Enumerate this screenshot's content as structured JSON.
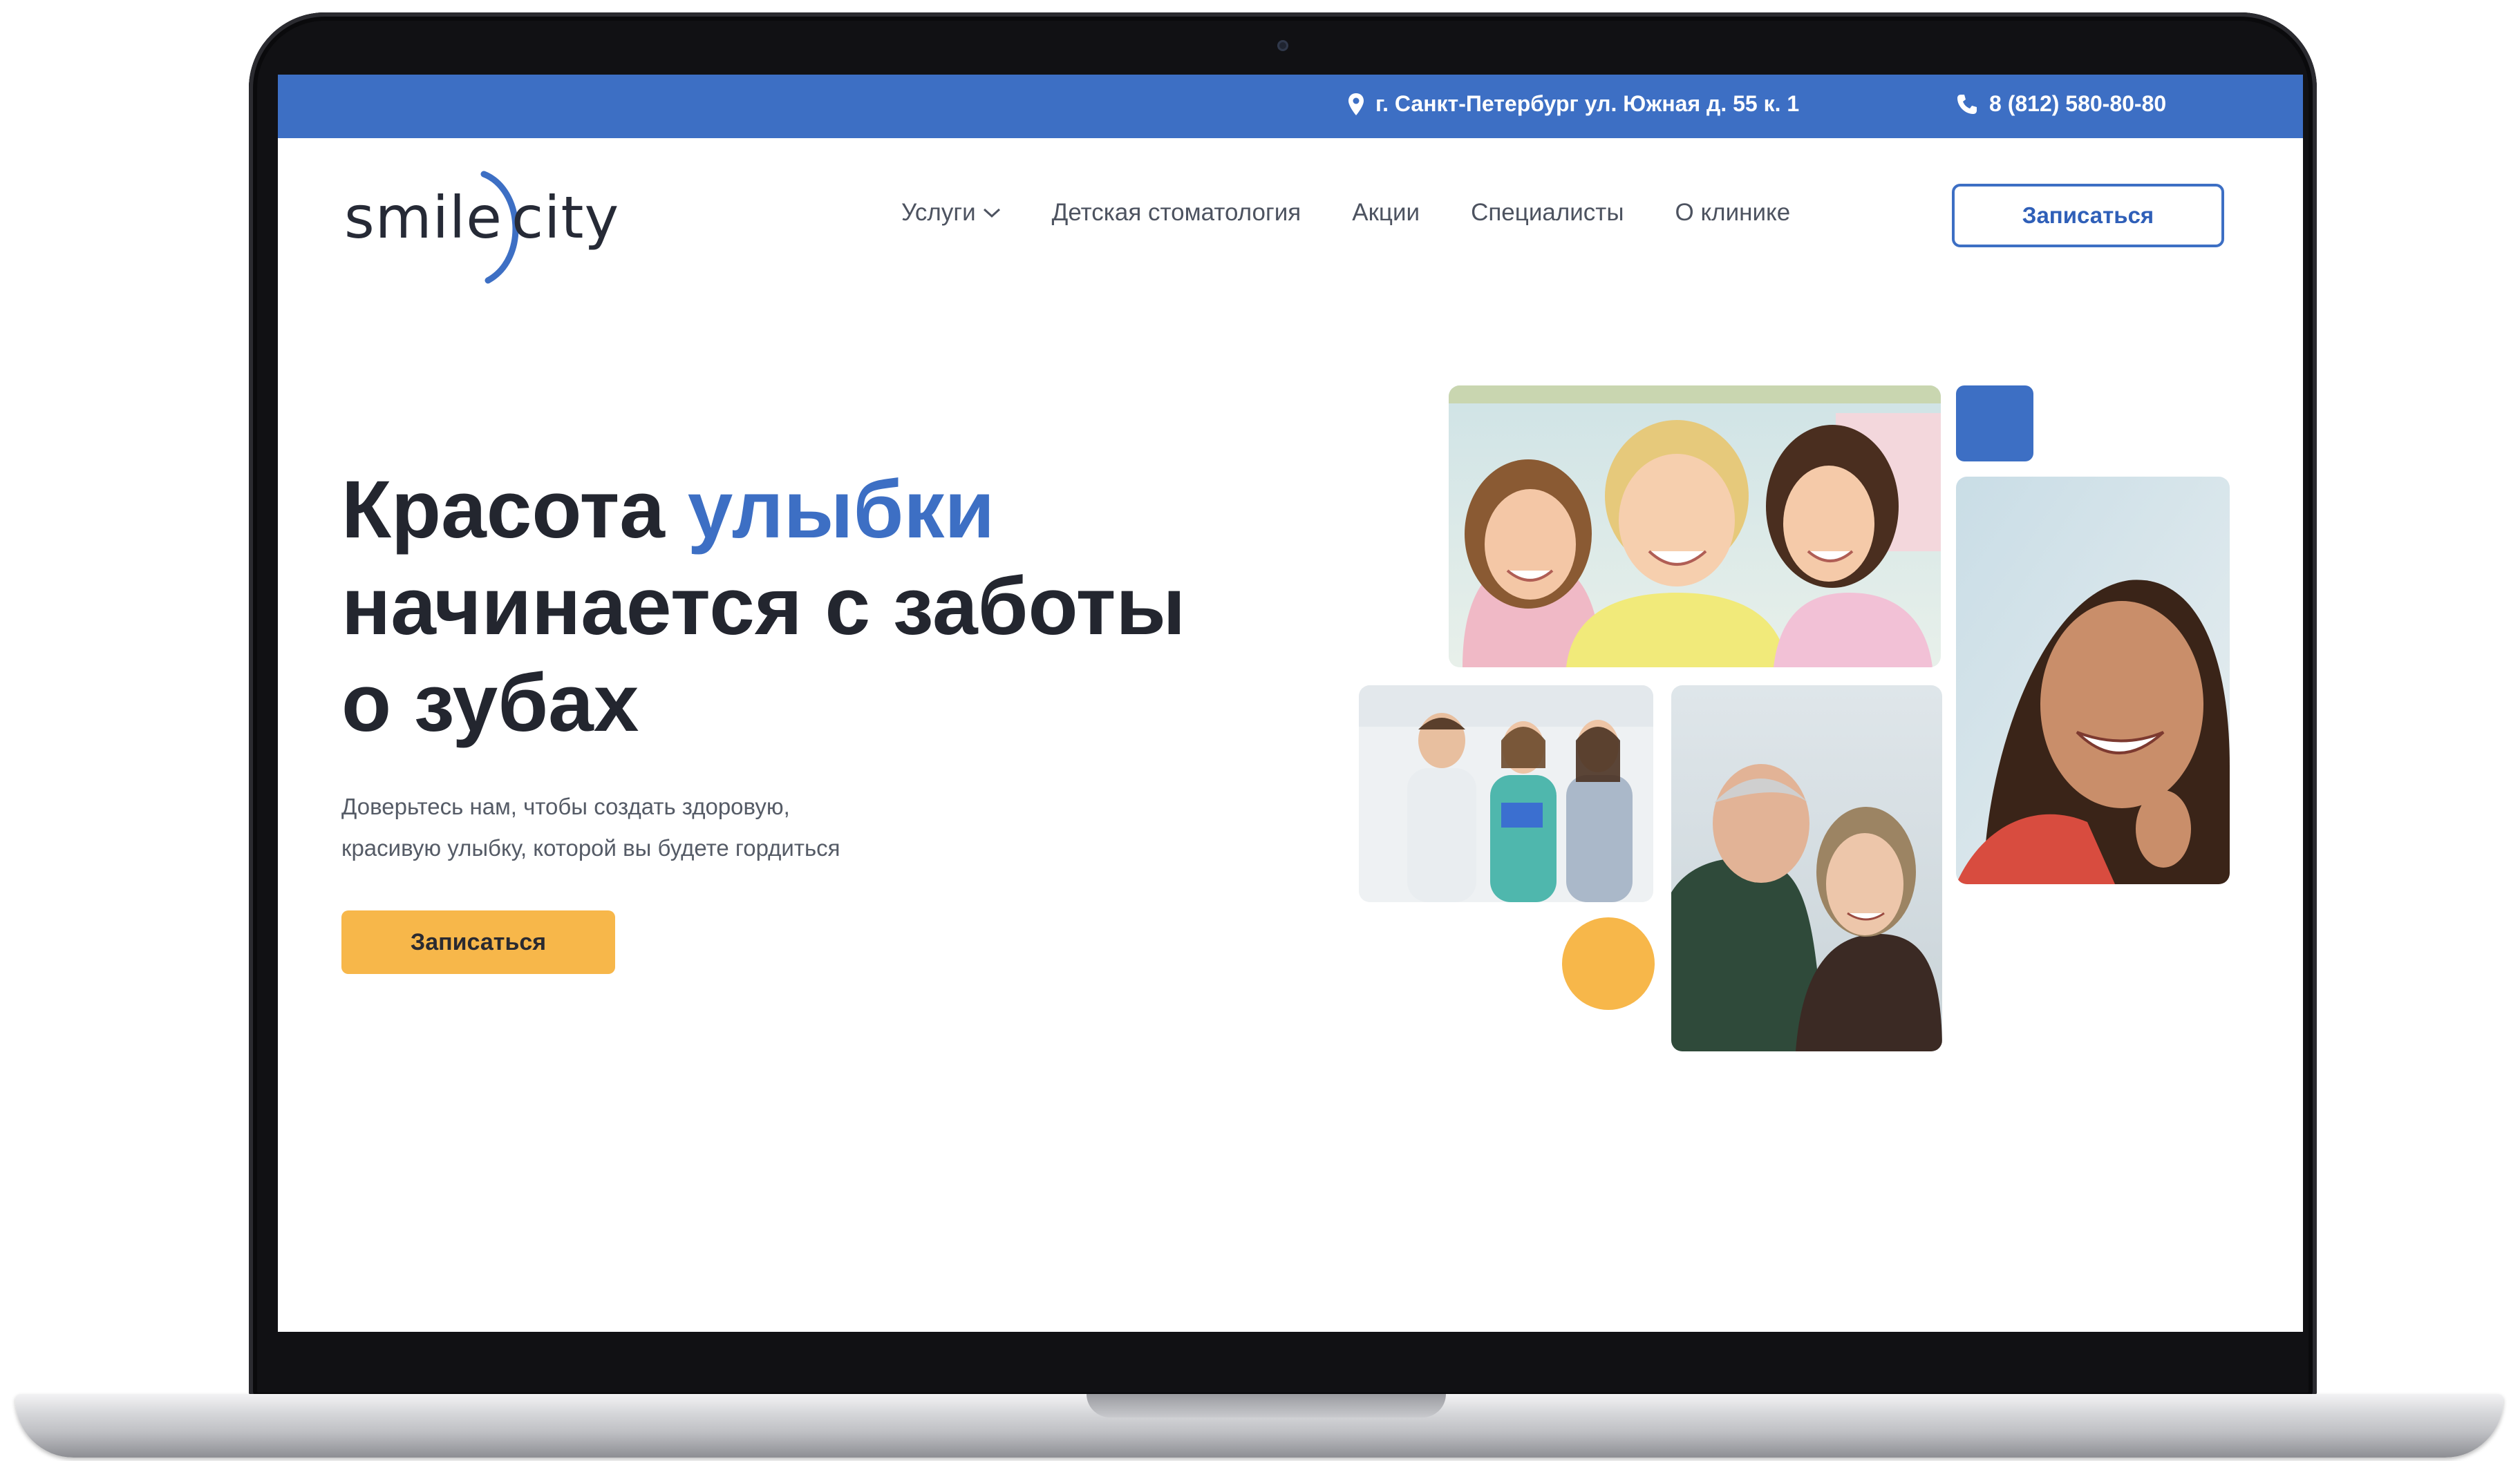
{
  "topbar": {
    "address": "г. Санкт-Петербург ул. Южная д. 55 к. 1",
    "phone": "8 (812) 580-80-80",
    "address_icon": "map-pin-icon",
    "phone_icon": "phone-icon"
  },
  "logo": {
    "part1": "smile",
    "part2": "city"
  },
  "nav": {
    "items": [
      {
        "label": "Услуги",
        "has_dropdown": true
      },
      {
        "label": "Детская стоматология"
      },
      {
        "label": "Акции"
      },
      {
        "label": "Специалисты"
      },
      {
        "label": "О клинике"
      }
    ],
    "cta_label": "Записаться"
  },
  "hero": {
    "title_part1": "Красота ",
    "title_accent": "улыбки",
    "title_line2": "начинается с заботы",
    "title_line3": "о зубах",
    "subtitle_line1": "Доверьтесь нам, чтобы создать здоровую,",
    "subtitle_line2": "красивую улыбку, которой вы будете гордиться",
    "cta_label": "Записаться"
  },
  "colors": {
    "brand_blue": "#3d6fc4",
    "accent_orange": "#f7b74a",
    "text_dark": "#23262f"
  }
}
